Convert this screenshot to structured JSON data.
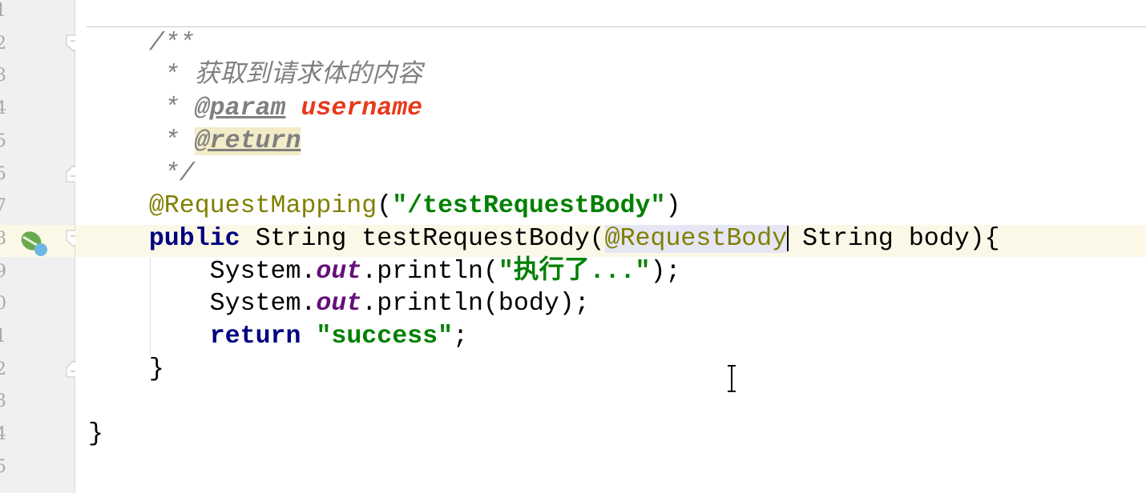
{
  "gutter": {
    "line_numbers": [
      "1",
      "2",
      "3",
      "4",
      "5",
      "5",
      "7",
      "8",
      "9",
      "0",
      "1",
      "2",
      "3",
      "4",
      "5"
    ]
  },
  "code": {
    "lines": [
      [],
      [
        {
          "t": "    /**",
          "c": "doc"
        }
      ],
      [
        {
          "t": "     * ",
          "c": "doc"
        },
        {
          "t": "获取到请求体的内容",
          "c": "doc"
        }
      ],
      [
        {
          "t": "     * ",
          "c": "doc"
        },
        {
          "t": "@param",
          "c": "doctag"
        },
        {
          "t": " ",
          "c": "doc"
        },
        {
          "t": "username",
          "c": "docparam"
        }
      ],
      [
        {
          "t": "     * ",
          "c": "doc"
        },
        {
          "t": "@return",
          "c": "doctaghl"
        }
      ],
      [
        {
          "t": "     */",
          "c": "doc"
        }
      ],
      [
        {
          "t": "    @RequestMapping",
          "c": "ann"
        },
        {
          "t": "(",
          "c": "plain"
        },
        {
          "t": "\"/testRequestBody\"",
          "c": "str"
        },
        {
          "t": ")",
          "c": "plain"
        }
      ],
      [
        {
          "t": "    ",
          "c": "plain"
        },
        {
          "t": "public",
          "c": "kw"
        },
        {
          "t": " String testRequestBody(",
          "c": "plain"
        },
        {
          "t": "@RequestBody",
          "c": "annsel"
        },
        {
          "t": "",
          "c": "caret"
        },
        {
          "t": " String body){",
          "c": "plain"
        }
      ],
      [
        {
          "t": "        System.",
          "c": "plain"
        },
        {
          "t": "out",
          "c": "field"
        },
        {
          "t": ".println(",
          "c": "plain"
        },
        {
          "t": "\"执行了...\"",
          "c": "str"
        },
        {
          "t": ");",
          "c": "plain"
        }
      ],
      [
        {
          "t": "        System.",
          "c": "plain"
        },
        {
          "t": "out",
          "c": "field"
        },
        {
          "t": ".println(body);",
          "c": "plain"
        }
      ],
      [
        {
          "t": "        ",
          "c": "plain"
        },
        {
          "t": "return",
          "c": "kw"
        },
        {
          "t": " ",
          "c": "plain"
        },
        {
          "t": "\"success\"",
          "c": "str"
        },
        {
          "t": ";",
          "c": "plain"
        }
      ],
      [
        {
          "t": "    }",
          "c": "plain"
        }
      ],
      [],
      [
        {
          "t": "}",
          "c": "plain"
        }
      ],
      []
    ]
  },
  "colors": {
    "keyword": "#000080",
    "string": "#008000",
    "annotation": "#808000",
    "doc": "#808080",
    "doc_param": "#e8391a",
    "field": "#660e7a",
    "current_line": "#fcf8e8"
  },
  "icons": {
    "gutter_marker": "spring-bean-icon",
    "folds": [
      "fold-start-icon",
      "fold-end-icon"
    ],
    "cursor": "text-cursor-icon"
  }
}
